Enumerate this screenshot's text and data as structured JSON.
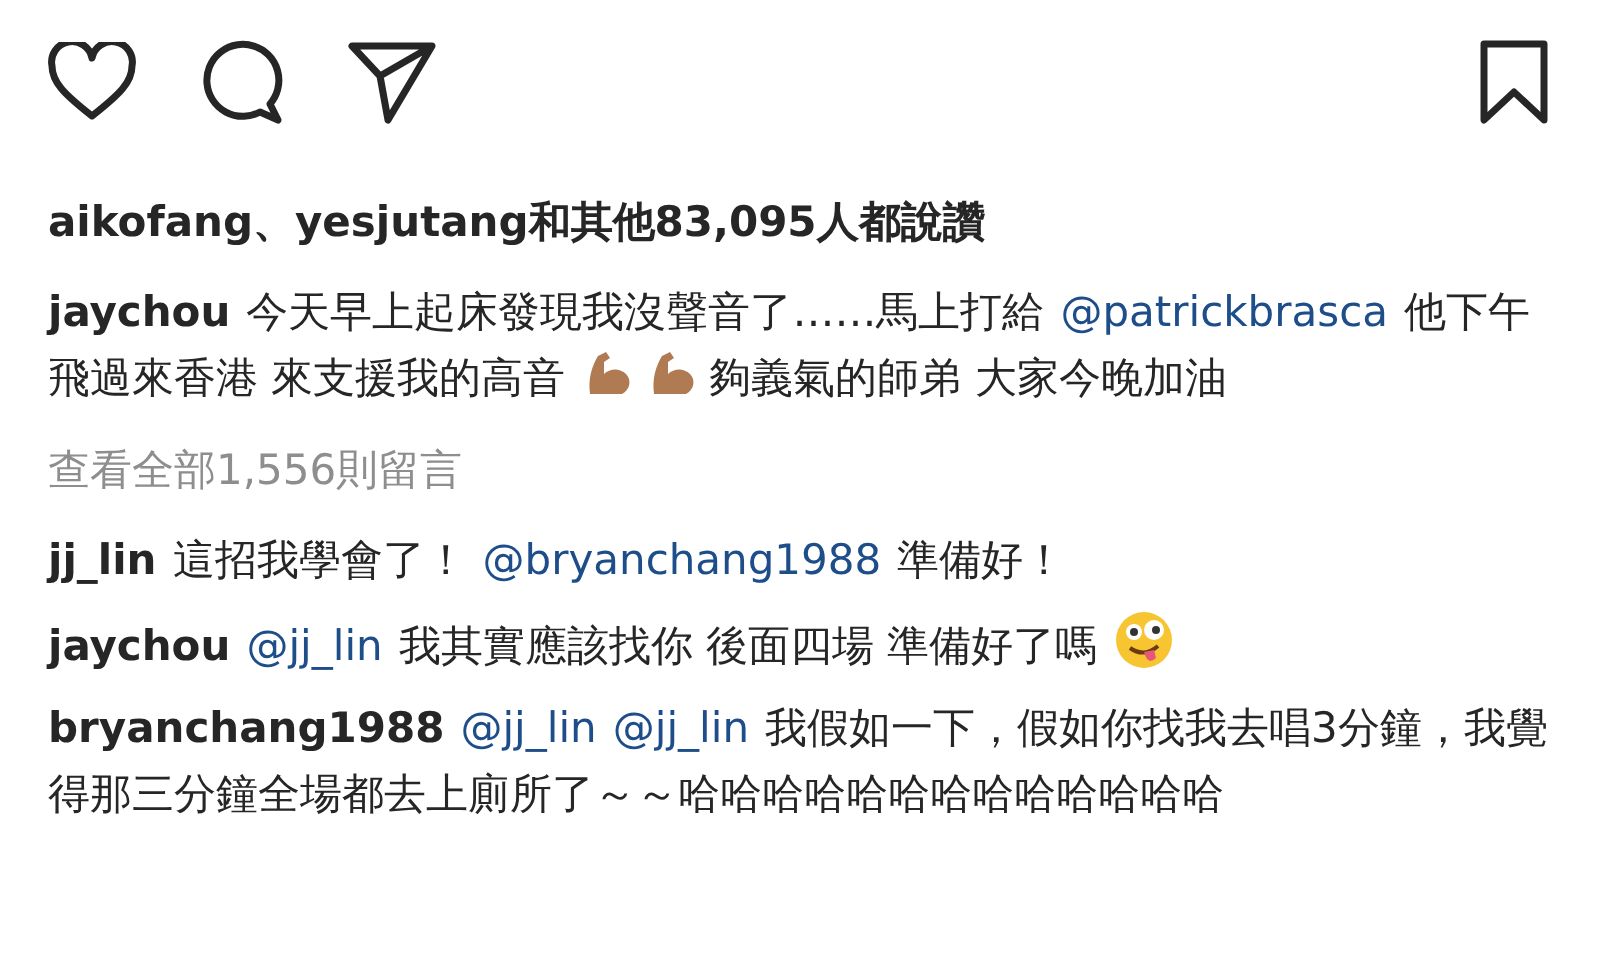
{
  "actions": {
    "bookmarked": false,
    "liked": false
  },
  "likes": "aikofang、yesjutang和其他83,095人都說讚",
  "view_all": "查看全部1,556則留言",
  "caption": {
    "user": "jaychou",
    "segments": [
      {
        "kind": "text",
        "text": "今天早上起床發現我沒聲音了……馬上打給"
      },
      {
        "kind": "mention",
        "text": "@patrickbrasca"
      },
      {
        "kind": "text",
        "text": "他下午飛過來香港 來支援我的高音"
      },
      {
        "kind": "muscle_emoji"
      },
      {
        "kind": "muscle_emoji"
      },
      {
        "kind": "text",
        "text": "夠義氣的師弟 大家今晚加油"
      }
    ]
  },
  "comments": [
    {
      "user": "jj_lin",
      "segments": [
        {
          "kind": "text",
          "text": "這招我學會了！"
        },
        {
          "kind": "mention",
          "text": "@bryanchang1988"
        },
        {
          "kind": "text",
          "text": "準備好！"
        }
      ]
    },
    {
      "user": "jaychou",
      "segments": [
        {
          "kind": "mention",
          "text": "@jj_lin"
        },
        {
          "kind": "text",
          "text": "我其實應該找你 後面四場 準備好了嗎"
        },
        {
          "kind": "silly_emoji"
        }
      ]
    },
    {
      "user": "bryanchang1988",
      "segments": [
        {
          "kind": "mention",
          "text": "@jj_lin"
        },
        {
          "kind": "mention",
          "text": "@jj_lin"
        },
        {
          "kind": "text",
          "text": "我假如一下，假如你找我去唱3分鐘，我覺得那三分鐘全場都去上廁所了～～哈哈哈哈哈哈哈哈哈哈哈哈哈"
        }
      ]
    }
  ]
}
